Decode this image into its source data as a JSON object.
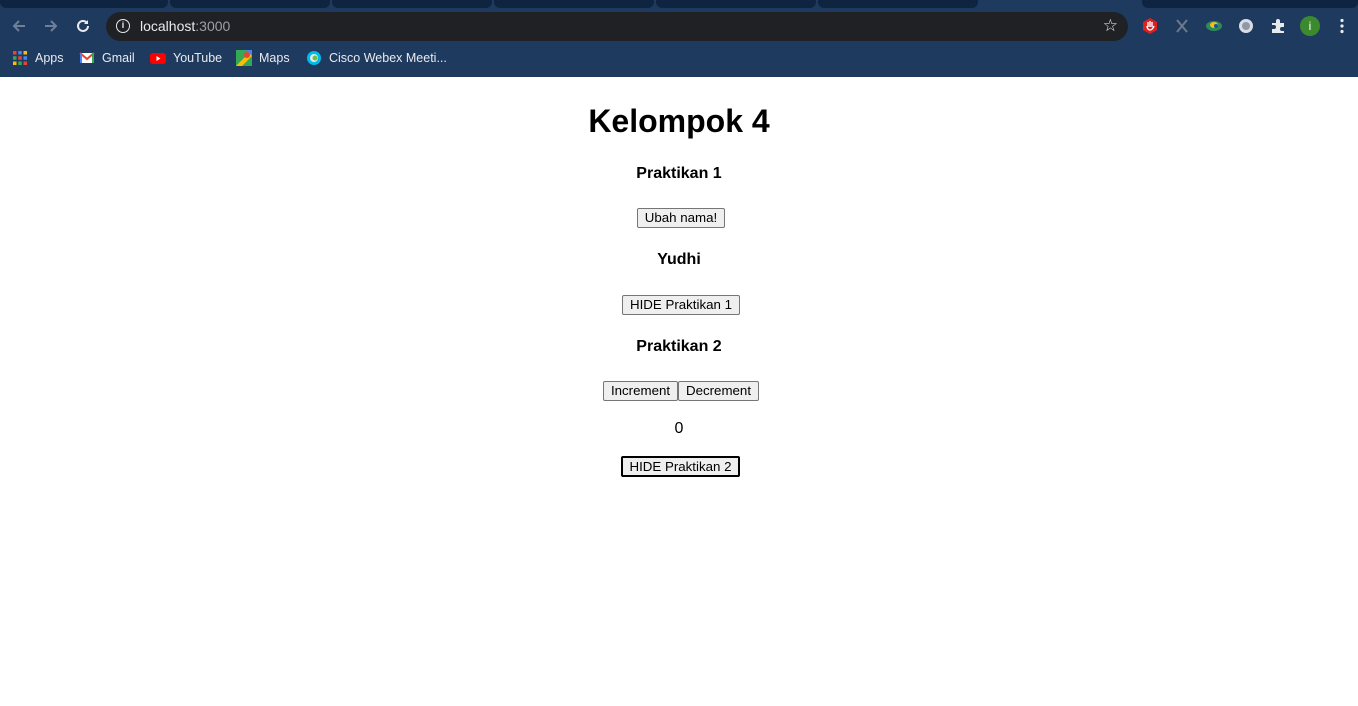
{
  "browser": {
    "url_host": "localhost",
    "url_port": ":3000",
    "bookmarks": [
      {
        "label": "Apps"
      },
      {
        "label": "Gmail"
      },
      {
        "label": "YouTube"
      },
      {
        "label": "Maps"
      },
      {
        "label": "Cisco Webex Meeti..."
      }
    ],
    "profile_initial": "i"
  },
  "page": {
    "title": "Kelompok 4",
    "section1_heading": "Praktikan 1",
    "change_name_button": "Ubah nama!",
    "name_display": "Yudhi",
    "hide1_button": "HIDE Praktikan 1",
    "section2_heading": "Praktikan 2",
    "increment_button": "Increment",
    "decrement_button": "Decrement",
    "counter_value": "0",
    "hide2_button": "HIDE Praktikan 2"
  },
  "colors": {
    "browser_frame": "#1e3a5f",
    "omnibox_bg": "#202124"
  }
}
